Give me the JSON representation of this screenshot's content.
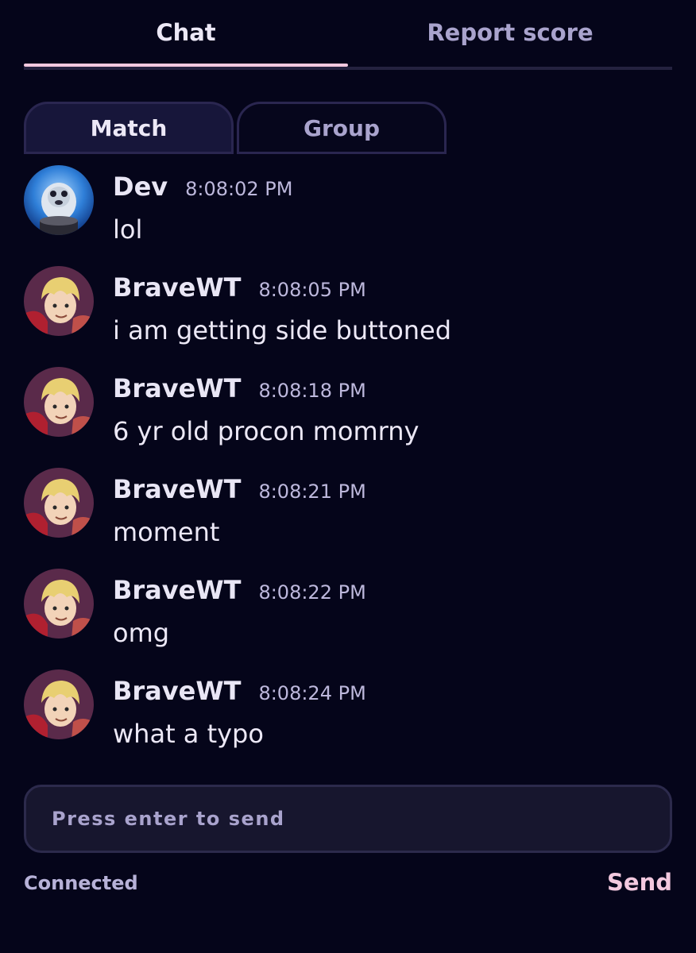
{
  "top_tabs": [
    {
      "label": "Chat",
      "active": true
    },
    {
      "label": "Report score",
      "active": false
    }
  ],
  "sub_tabs": [
    {
      "label": "Match",
      "active": true
    },
    {
      "label": "Group",
      "active": false
    }
  ],
  "messages": [
    {
      "user": "Dev",
      "time": "8:08:02 PM",
      "text": "lol",
      "avatar": "dev-avatar"
    },
    {
      "user": "BraveWT",
      "time": "8:08:05 PM",
      "text": "i am getting side buttoned",
      "avatar": "bravewt-avatar"
    },
    {
      "user": "BraveWT",
      "time": "8:08:18 PM",
      "text": "6 yr old procon momrny",
      "avatar": "bravewt-avatar"
    },
    {
      "user": "BraveWT",
      "time": "8:08:21 PM",
      "text": "moment",
      "avatar": "bravewt-avatar"
    },
    {
      "user": "BraveWT",
      "time": "8:08:22 PM",
      "text": "omg",
      "avatar": "bravewt-avatar"
    },
    {
      "user": "BraveWT",
      "time": "8:08:24 PM",
      "text": "what a typo",
      "avatar": "bravewt-avatar"
    }
  ],
  "input": {
    "placeholder": "Press enter to send"
  },
  "footer": {
    "status": "Connected",
    "send_label": "Send"
  },
  "colors": {
    "background": "#05051a",
    "accent": "#f3c9df",
    "muted_text": "#a9a3cd"
  }
}
